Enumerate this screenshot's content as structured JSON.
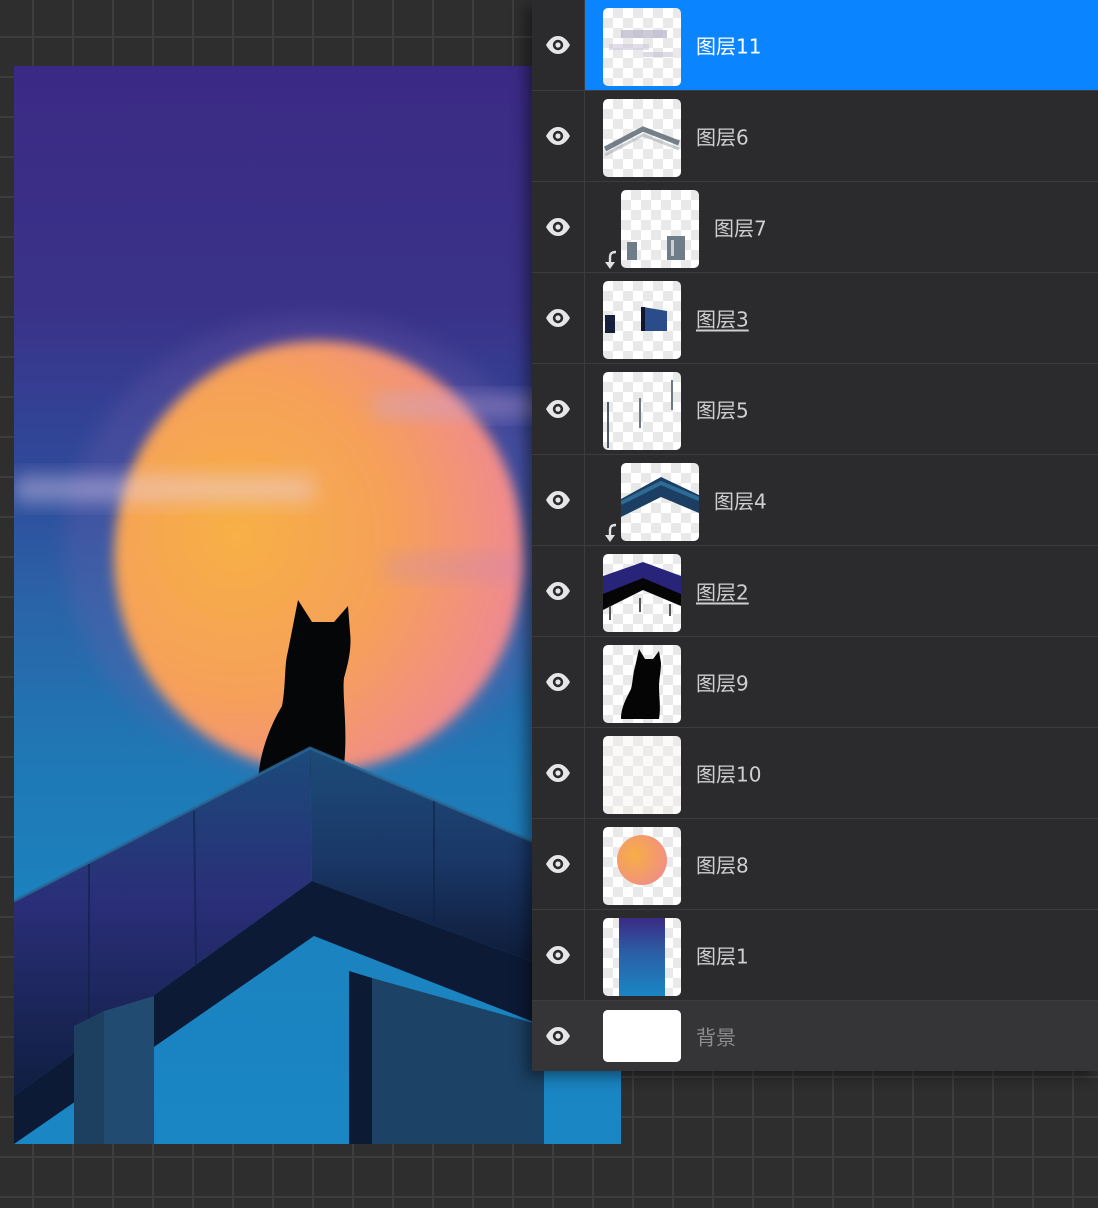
{
  "layers_panel": {
    "eye_icon": "eye-icon",
    "clip_icon": "clipping-mask-arrow-icon",
    "selected_color": "#0a84ff",
    "layers": [
      {
        "id": "11",
        "name": "图层11",
        "selected": true,
        "clipped": false,
        "underlined": false
      },
      {
        "id": "6",
        "name": "图层6",
        "selected": false,
        "clipped": false,
        "underlined": false
      },
      {
        "id": "7",
        "name": "图层7",
        "selected": false,
        "clipped": true,
        "underlined": false
      },
      {
        "id": "3",
        "name": "图层3",
        "selected": false,
        "clipped": false,
        "underlined": true
      },
      {
        "id": "5",
        "name": "图层5",
        "selected": false,
        "clipped": false,
        "underlined": false
      },
      {
        "id": "4",
        "name": "图层4",
        "selected": false,
        "clipped": true,
        "underlined": false
      },
      {
        "id": "2",
        "name": "图层2",
        "selected": false,
        "clipped": false,
        "underlined": true
      },
      {
        "id": "9",
        "name": "图层9",
        "selected": false,
        "clipped": false,
        "underlined": false
      },
      {
        "id": "10",
        "name": "图层10",
        "selected": false,
        "clipped": false,
        "underlined": false
      },
      {
        "id": "8",
        "name": "图层8",
        "selected": false,
        "clipped": false,
        "underlined": false
      },
      {
        "id": "1",
        "name": "图层1",
        "selected": false,
        "clipped": false,
        "underlined": false
      },
      {
        "id": "bg",
        "name": "背景",
        "selected": false,
        "clipped": false,
        "underlined": false
      }
    ]
  },
  "artwork": {
    "subject": "cat-silhouette-on-rooftop-with-moon",
    "sky_colors": [
      "#3b2a85",
      "#2a64a8",
      "#1a86c4"
    ],
    "moon_colors": [
      "#f6a848",
      "#f08a8a"
    ],
    "cat_color": "#050608"
  }
}
